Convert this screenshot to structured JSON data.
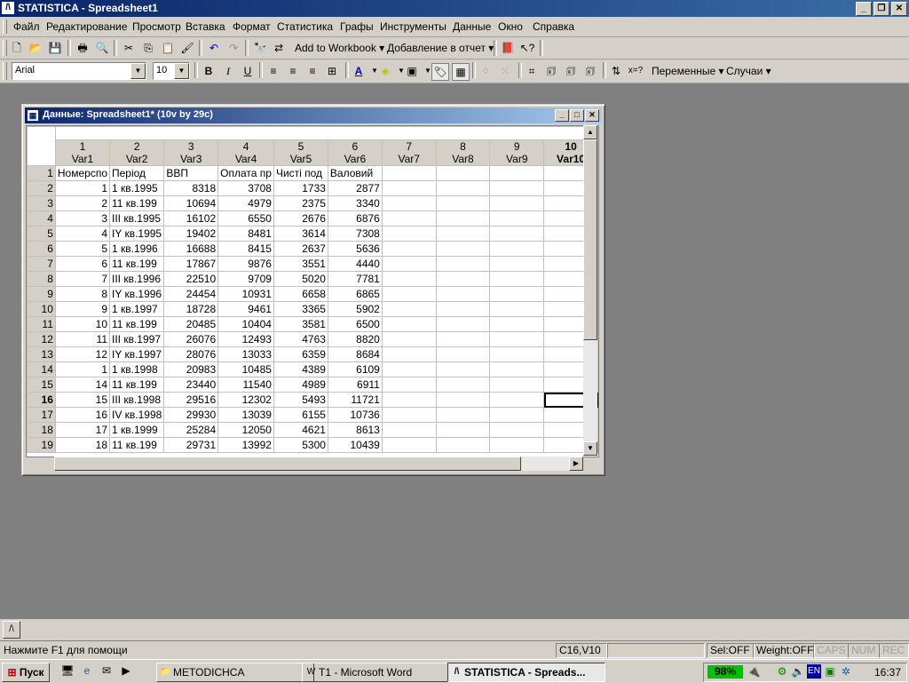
{
  "app": {
    "title": "STATISTICA - Spreadsheet1"
  },
  "menu": [
    "Файл",
    "Редактирование",
    "Просмотр",
    "Вставка",
    "Формат",
    "Статистика",
    "Графы",
    "Инструменты",
    "Данные",
    "Окно",
    "Справка"
  ],
  "toolbar1": {
    "add_to_workbook": "Add to Workbook",
    "add_to_report": "Добавление в отчет"
  },
  "toolbar2": {
    "font": "Arial",
    "size": "10",
    "bold": "B",
    "italic": "I",
    "underline": "U",
    "variables": "Переменные",
    "cases": "Случаи",
    "icons": [
      "text-color-icon",
      "fill-color-icon",
      "borders-icon",
      "highlight-icon",
      "grid-lines-icon"
    ]
  },
  "window": {
    "title": "Данные: Spreadsheet1* (10v by 29c)"
  },
  "grid": {
    "columns": [
      {
        "num": "1",
        "name": "Var1"
      },
      {
        "num": "2",
        "name": "Var2"
      },
      {
        "num": "3",
        "name": "Var3"
      },
      {
        "num": "4",
        "name": "Var4"
      },
      {
        "num": "5",
        "name": "Var5"
      },
      {
        "num": "6",
        "name": "Var6"
      },
      {
        "num": "7",
        "name": "Var7"
      },
      {
        "num": "8",
        "name": "Var8"
      },
      {
        "num": "9",
        "name": "Var9"
      },
      {
        "num": "10",
        "name": "Var10"
      }
    ],
    "rows": [
      {
        "n": "1",
        "cells": [
          "Номерспо",
          "Період",
          "ВВП",
          "Оплата пр",
          "Чисті под",
          "Валовий",
          "",
          "",
          "",
          ""
        ]
      },
      {
        "n": "2",
        "cells": [
          "1",
          "1 кв.1995",
          "8318",
          "3708",
          "1733",
          "2877",
          "",
          "",
          "",
          ""
        ]
      },
      {
        "n": "3",
        "cells": [
          "2",
          "11 кв.199",
          "10694",
          "4979",
          "2375",
          "3340",
          "",
          "",
          "",
          ""
        ]
      },
      {
        "n": "4",
        "cells": [
          "3",
          "III кв.1995",
          "16102",
          "6550",
          "2676",
          "6876",
          "",
          "",
          "",
          ""
        ]
      },
      {
        "n": "5",
        "cells": [
          "4",
          "IY кв.1995",
          "19402",
          "8481",
          "3614",
          "7308",
          "",
          "",
          "",
          ""
        ]
      },
      {
        "n": "6",
        "cells": [
          "5",
          "1 кв.1996",
          "16688",
          "8415",
          "2637",
          "5636",
          "",
          "",
          "",
          ""
        ]
      },
      {
        "n": "7",
        "cells": [
          "6",
          "11 кв.199",
          "17867",
          "9876",
          "3551",
          "4440",
          "",
          "",
          "",
          ""
        ]
      },
      {
        "n": "8",
        "cells": [
          "7",
          "III кв.1996",
          "22510",
          "9709",
          "5020",
          "7781",
          "",
          "",
          "",
          ""
        ]
      },
      {
        "n": "9",
        "cells": [
          "8",
          "IY кв.1996",
          "24454",
          "10931",
          "6658",
          "6865",
          "",
          "",
          "",
          ""
        ]
      },
      {
        "n": "10",
        "cells": [
          "9",
          "1 кв.1997",
          "18728",
          "9461",
          "3365",
          "5902",
          "",
          "",
          "",
          ""
        ]
      },
      {
        "n": "11",
        "cells": [
          "10",
          "11 кв.199",
          "20485",
          "10404",
          "3581",
          "6500",
          "",
          "",
          "",
          ""
        ]
      },
      {
        "n": "12",
        "cells": [
          "11",
          "III кв.1997",
          "26076",
          "12493",
          "4763",
          "8820",
          "",
          "",
          "",
          ""
        ]
      },
      {
        "n": "13",
        "cells": [
          "12",
          "IY кв.1997",
          "28076",
          "13033",
          "6359",
          "8684",
          "",
          "",
          "",
          ""
        ]
      },
      {
        "n": "14",
        "cells": [
          "1",
          "1 кв.1998",
          "20983",
          "10485",
          "4389",
          "6109",
          "",
          "",
          "",
          ""
        ]
      },
      {
        "n": "15",
        "cells": [
          "14",
          "11 кв.199",
          "23440",
          "11540",
          "4989",
          "6911",
          "",
          "",
          "",
          ""
        ]
      },
      {
        "n": "16",
        "cells": [
          "15",
          "III кв.1998",
          "29516",
          "12302",
          "5493",
          "11721",
          "",
          "",
          "",
          ""
        ]
      },
      {
        "n": "17",
        "cells": [
          "16",
          "IV кв.1998",
          "29930",
          "13039",
          "6155",
          "10736",
          "",
          "",
          "",
          ""
        ]
      },
      {
        "n": "18",
        "cells": [
          "17",
          "1 кв.1999",
          "25284",
          "12050",
          "4621",
          "8613",
          "",
          "",
          "",
          ""
        ]
      },
      {
        "n": "19",
        "cells": [
          "18",
          "11 кв.199",
          "29731",
          "13992",
          "5300",
          "10439",
          "",
          "",
          "",
          ""
        ]
      }
    ],
    "active_row": "16",
    "active_col": "10"
  },
  "status": {
    "help": "Нажмите F1 для помощи",
    "cell": "C16,V10",
    "sel": "Sel:OFF",
    "weight": "Weight:OFF",
    "caps": "CAPS",
    "num": "NUM",
    "rec": "REC"
  },
  "taskbar": {
    "start": "Пуск",
    "tasks": [
      "METODICHCA",
      "T1 - Microsoft Word",
      "STATISTICA - Spreads..."
    ],
    "battery": "98%",
    "lang": "EN",
    "clock": "16:37"
  }
}
